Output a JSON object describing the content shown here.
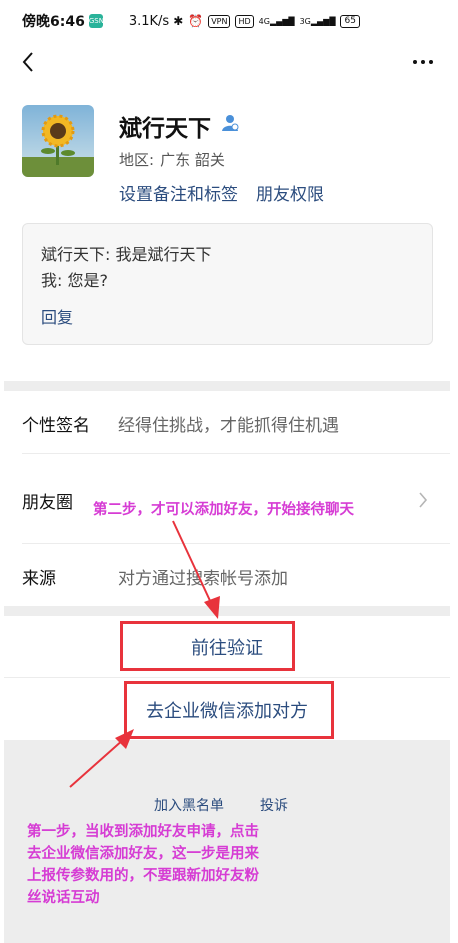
{
  "status_bar": {
    "time": "傍晚6:46",
    "speed": "3.1K/s",
    "badge": "GSN",
    "vpn": "VPN",
    "hd": "HD",
    "net1": "4G",
    "net2": "3G",
    "battery": "65"
  },
  "profile": {
    "name": "斌行天下",
    "region_label": "地区:",
    "region_value": "广东  韶关",
    "set_remark": "设置备注和标签",
    "friend_permission": "朋友权限"
  },
  "message": {
    "line1": "斌行天下: 我是斌行天下",
    "line2": "我: 您是?",
    "reply": "回复"
  },
  "rows": {
    "signature_label": "个性签名",
    "signature_value": "经得住挑战，才能抓得住机遇",
    "moments_label": "朋友圈",
    "source_label": "来源",
    "source_value": "对方通过搜索帐号添加"
  },
  "buttons": {
    "verify": "前往验证",
    "wecom_add": "去企业微信添加对方"
  },
  "bottom": {
    "blacklist": "加入黑名单",
    "report": "投诉"
  },
  "annotations": {
    "step2": "第二步，才可以添加好友，开始接待聊天",
    "step1_line1": "第一步，当收到添加好友申请，点击",
    "step1_line2": "去企业微信添加好友，这一步是用来",
    "step1_line3": "上报传参数用的，不要跟新加好友粉",
    "step1_line4": "丝说话互动"
  },
  "colors": {
    "link": "#2b4c7e",
    "annotation_red": "#e8333c",
    "annotation_text": "#d63cd4"
  }
}
